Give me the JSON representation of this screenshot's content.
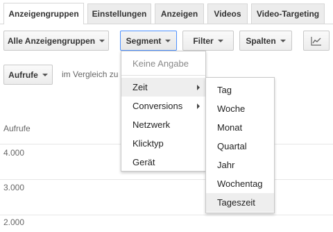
{
  "tabs": [
    {
      "label": "Anzeigengruppen",
      "active": true
    },
    {
      "label": "Einstellungen",
      "active": false
    },
    {
      "label": "Anzeigen",
      "active": false
    },
    {
      "label": "Videos",
      "active": false
    },
    {
      "label": "Video-Targeting",
      "active": false
    }
  ],
  "toolbar": {
    "filter_group": "Alle Anzeigengruppen",
    "segment": "Segment",
    "filter": "Filter",
    "columns": "Spalten",
    "chart_icon": "line-chart-icon"
  },
  "metric": {
    "selector": "Aufrufe",
    "compare_text": "im Vergleich zu"
  },
  "chart": {
    "axis_title": "Aufrufe",
    "ticks": [
      "4.000",
      "3.000",
      "2.000"
    ]
  },
  "segment_menu": {
    "items": [
      {
        "label": "Keine Angabe",
        "disabled": true
      },
      {
        "label": "Zeit",
        "submenu": true,
        "hover": true
      },
      {
        "label": "Conversions",
        "submenu": true
      },
      {
        "label": "Netzwerk"
      },
      {
        "label": "Klicktyp"
      },
      {
        "label": "Gerät"
      }
    ]
  },
  "time_submenu": {
    "items": [
      {
        "label": "Tag"
      },
      {
        "label": "Woche"
      },
      {
        "label": "Monat"
      },
      {
        "label": "Quartal"
      },
      {
        "label": "Jahr"
      },
      {
        "label": "Wochentag"
      },
      {
        "label": "Tageszeit",
        "hover": true
      }
    ]
  },
  "colors": {
    "focus_border": "#4d90fe",
    "hover_bg": "#eeeeee",
    "tab_bg": "#ececec"
  }
}
